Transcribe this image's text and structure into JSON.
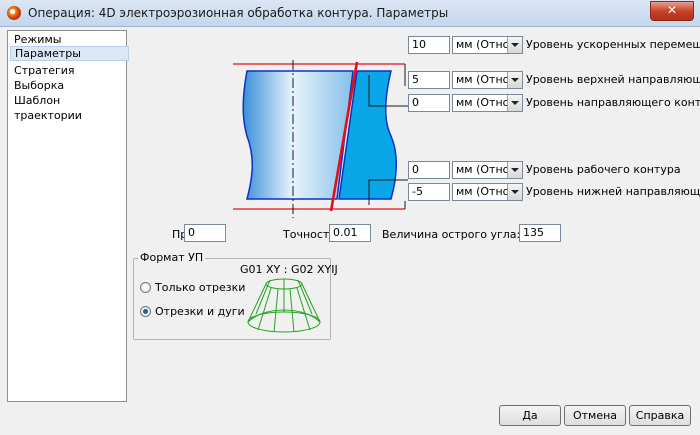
{
  "window": {
    "title": "Операция: 4D электроэрозионная обработка контура. Параметры",
    "close_label": "✕"
  },
  "nav": {
    "items": [
      {
        "label": "Режимы",
        "selected": false
      },
      {
        "label": "Параметры",
        "selected": true
      },
      {
        "label": "Стратегия",
        "selected": false
      },
      {
        "label": "Выборка",
        "selected": false
      },
      {
        "label": "Шаблон траектории",
        "selected": false
      }
    ]
  },
  "levels": {
    "rapid": {
      "value": "10",
      "unit": "мм (Относи",
      "label": "Уровень ускоренных перемещений"
    },
    "upper_guide": {
      "value": "5",
      "unit": "мм (Относи",
      "label": "Уровень верхней направляющей"
    },
    "guide_contour": {
      "value": "0",
      "unit": "мм (Относи",
      "label": "Уровень направляющего контура"
    },
    "work_contour": {
      "value": "0",
      "unit": "мм (Относи",
      "label": "Уровень рабочего контура"
    },
    "lower_guide": {
      "value": "-5",
      "unit": "мм (Относи",
      "label": "Уровень нижней направляющей"
    }
  },
  "params": {
    "allowance_label": "Припуск:",
    "allowance_value": "0",
    "accuracy_label": "Точность:",
    "accuracy_value": "0.01",
    "sharp_angle_label": "Величина острого угла:",
    "sharp_angle_value": "135"
  },
  "format": {
    "title": "Формат УП",
    "code_label": "G01 XY : G02 XYIJ",
    "option_segments": "Только отрезки",
    "option_segments_arcs": "Отрезки и дуги",
    "selected": "segments_arcs"
  },
  "buttons": {
    "ok": "Да",
    "cancel": "Отмена",
    "help": "Справка"
  },
  "colors": {
    "accent_red": "#e0101a",
    "part_blue": "#0aa7e8",
    "wire_green": "#1fa51f"
  }
}
